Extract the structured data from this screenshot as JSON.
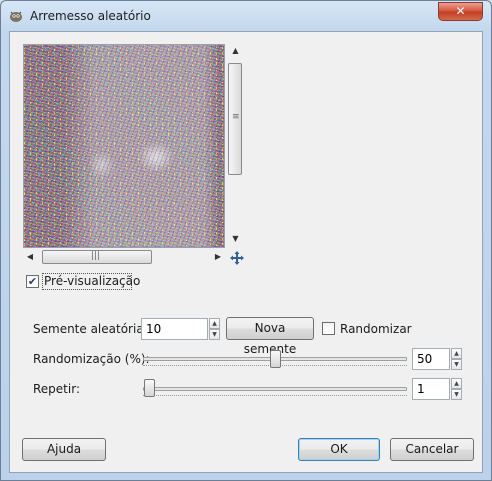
{
  "window": {
    "title": "Arremesso aleatório",
    "close_label": "✕"
  },
  "preview": {
    "checkbox_label": "Pré-visualização",
    "checked": true
  },
  "seed": {
    "label": "Semente aleatória:",
    "value": "10",
    "new_seed_label": "Nova semente",
    "randomize_label": "Randomizar",
    "randomize_checked": false
  },
  "randomization": {
    "label": "Randomização (%):",
    "value": "50",
    "percent": 50
  },
  "repeat": {
    "label": "Repetir:",
    "value": "1",
    "min": 1,
    "max": 100
  },
  "buttons": {
    "help": "Ajuda",
    "ok": "OK",
    "cancel": "Cancelar"
  },
  "icons": {
    "app": "gimp-icon",
    "navigate": "navigate-icon"
  }
}
